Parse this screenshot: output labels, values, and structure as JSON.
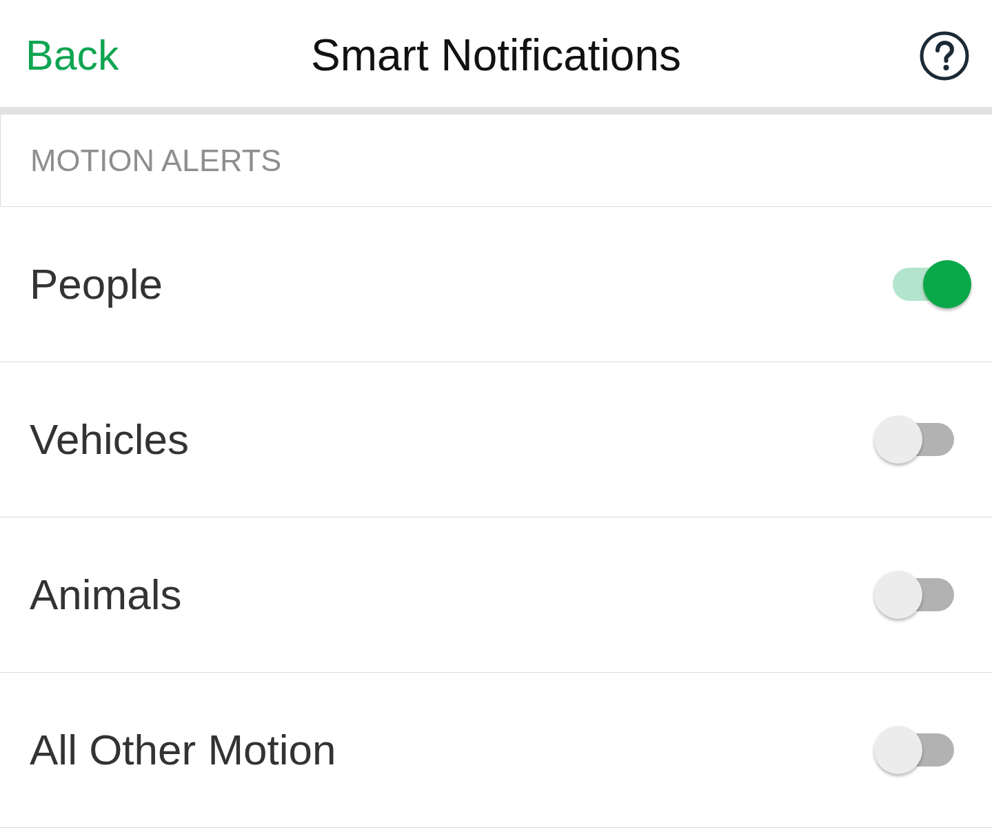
{
  "header": {
    "back_label": "Back",
    "title": "Smart Notifications"
  },
  "section": {
    "title": "MOTION ALERTS"
  },
  "rows": [
    {
      "label": "People",
      "on": true
    },
    {
      "label": "Vehicles",
      "on": false
    },
    {
      "label": "Animals",
      "on": false
    },
    {
      "label": "All Other Motion",
      "on": false
    }
  ]
}
